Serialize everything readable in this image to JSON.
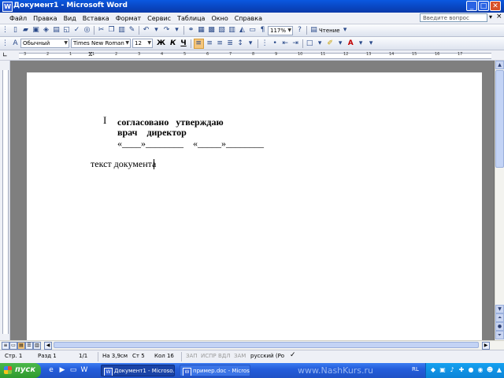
{
  "window": {
    "title": "Документ1 - Microsoft Word"
  },
  "menu": {
    "items": [
      "Файл",
      "Правка",
      "Вид",
      "Вставка",
      "Формат",
      "Сервис",
      "Таблица",
      "Окно",
      "Справка"
    ],
    "help_placeholder": "Введите вопрос"
  },
  "toolbar": {
    "zoom": "117%",
    "reading_label": "Чтение",
    "style": "Обычный",
    "font": "Times New Roman",
    "size": "12",
    "bold_label": "Ж",
    "italic_label": "К",
    "underline_label": "Ч"
  },
  "document": {
    "lines": [
      "согласовано   утверждаю",
      "врач    директор",
      "«____»________    «_____»________",
      "текст документа"
    ]
  },
  "status": {
    "page": "Стр. 1",
    "section": "Разд 1",
    "pages": "1/1",
    "position": "На 3,9см",
    "line": "Ст 5",
    "column": "Кол 16",
    "rec": "ЗАП",
    "trk": "ИСПР",
    "ext": "ВДЛ",
    "ovr": "ЗАМ",
    "language": "русский (Ро"
  },
  "taskbar": {
    "start_label": "пуск",
    "tasks": [
      "Документ1 - Microso...",
      "пример.doc - Microso..."
    ],
    "watermark": "www.NashKurs.ru",
    "language": "RL"
  },
  "ruler_numbers": [
    "3",
    "2",
    "1",
    "1",
    "2",
    "3",
    "4",
    "5",
    "6",
    "7",
    "8",
    "9",
    "10",
    "11",
    "12",
    "13",
    "14",
    "15",
    "16",
    "17"
  ]
}
